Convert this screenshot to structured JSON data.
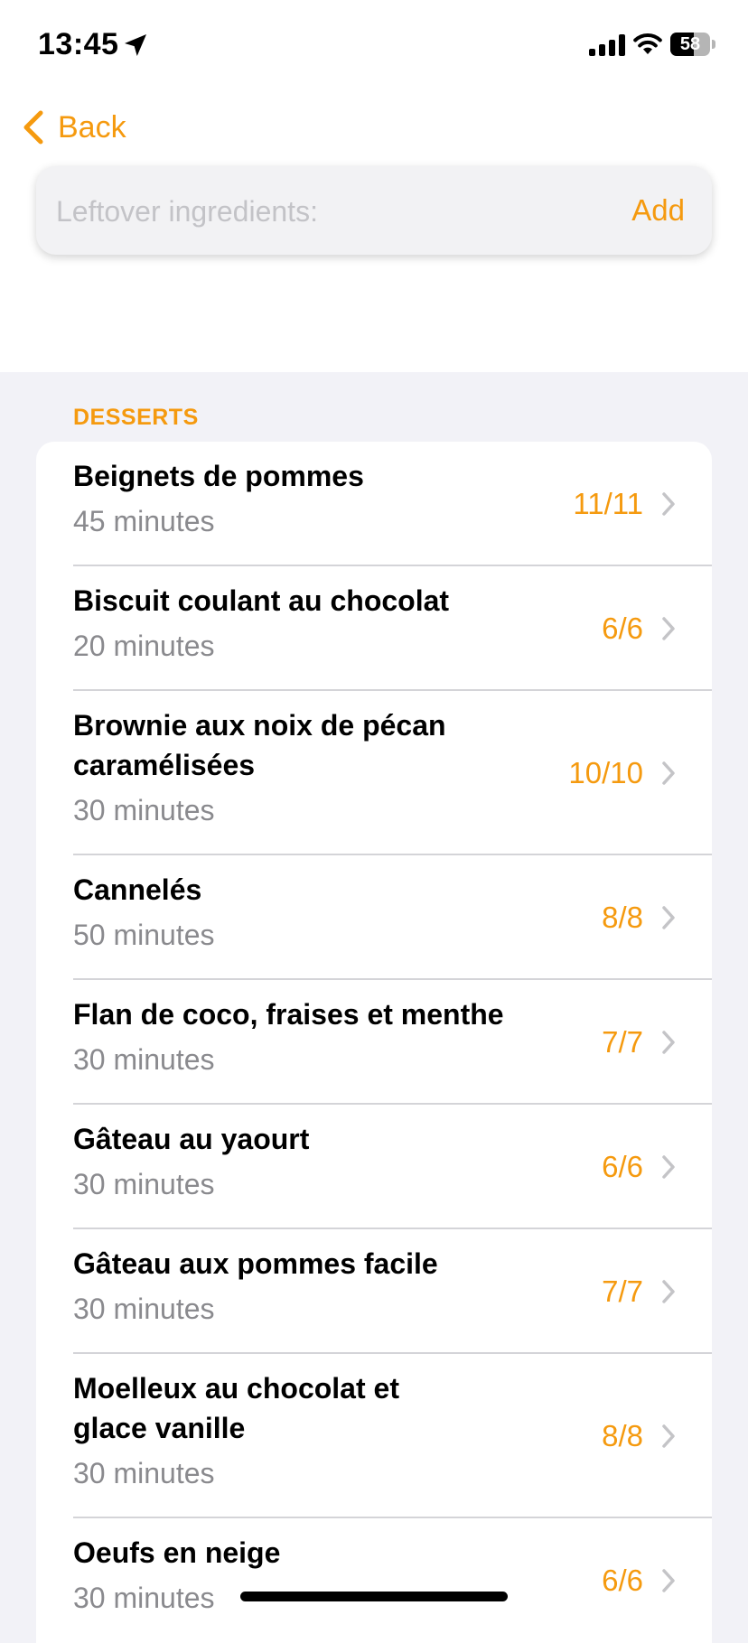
{
  "status_bar": {
    "time": "13:45",
    "battery": "58",
    "battery_level": 0.58
  },
  "nav": {
    "back_label": "Back"
  },
  "search": {
    "placeholder": "Leftover ingredients:",
    "value": "",
    "add_label": "Add"
  },
  "section": {
    "title": "DESSERTS",
    "recipes": [
      {
        "title": "Beignets de pommes",
        "time": "45 minutes",
        "count": "11/11"
      },
      {
        "title": "Biscuit coulant au chocolat",
        "time": "20 minutes",
        "count": "6/6"
      },
      {
        "title": "Brownie aux noix de pécan\ncaramélisées",
        "time": "30 minutes",
        "count": "10/10"
      },
      {
        "title": "Cannelés",
        "time": "50 minutes",
        "count": "8/8"
      },
      {
        "title": "Flan de coco, fraises et menthe",
        "time": "30 minutes",
        "count": "7/7"
      },
      {
        "title": "Gâteau au yaourt",
        "time": "30 minutes",
        "count": "6/6"
      },
      {
        "title": "Gâteau aux pommes facile",
        "time": "30 minutes",
        "count": "7/7"
      },
      {
        "title": "Moelleux au chocolat et\nglace vanille",
        "time": "30 minutes",
        "count": "8/8"
      },
      {
        "title": "Oeufs en neige",
        "time": "30 minutes",
        "count": "6/6"
      }
    ]
  },
  "colors": {
    "accent": "#f59a0f",
    "secondary_text": "#8a8a8e",
    "grouped_background": "#f2f2f7"
  },
  "icons": {
    "status": [
      "location-arrow-icon",
      "cellular-signal-icon",
      "wifi-icon",
      "battery-icon"
    ],
    "nav": "chevron-left-icon",
    "row": "chevron-right-icon"
  }
}
